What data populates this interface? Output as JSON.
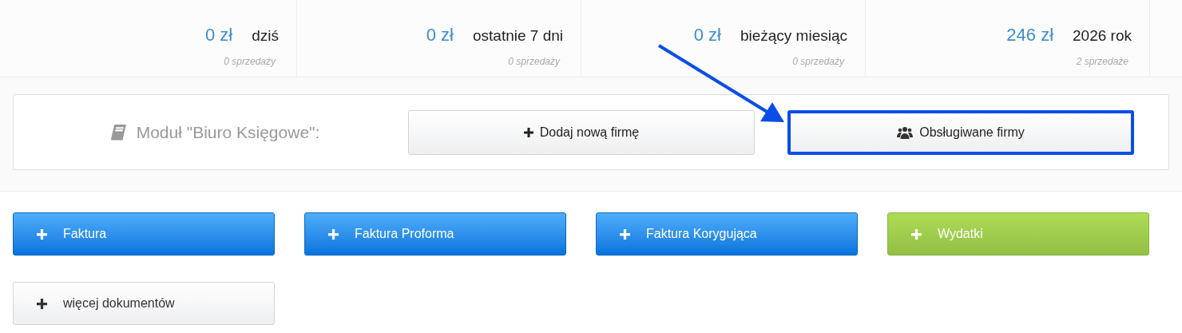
{
  "stats": [
    {
      "amount": "0 zł",
      "period": "dziś",
      "sales": "0 sprzedaży"
    },
    {
      "amount": "0 zł",
      "period": "ostatnie 7 dni",
      "sales": "0 sprzedaży"
    },
    {
      "amount": "0 zł",
      "period": "bieżący miesiąc",
      "sales": "0 sprzedaży"
    },
    {
      "amount": "246 zł",
      "period": "2026 rok",
      "sales": "2 sprzedaże"
    }
  ],
  "module": {
    "label": "Moduł \"Biuro Księgowe\":",
    "buttons": [
      {
        "label": "Dodaj nową firmę",
        "kind": "add",
        "highlighted": false
      },
      {
        "label": "Obsługiwane firmy",
        "kind": "clients",
        "highlighted": true
      }
    ]
  },
  "annotation": {
    "arrow": true
  },
  "documents": [
    {
      "label": "Faktura",
      "kind": "primary"
    },
    {
      "label": "Faktura Proforma",
      "kind": "primary"
    },
    {
      "label": "Faktura Korygująca",
      "kind": "primary"
    },
    {
      "label": "Wydatki",
      "kind": "success"
    },
    {
      "label": "więcej dokumentów",
      "kind": "default"
    }
  ]
}
